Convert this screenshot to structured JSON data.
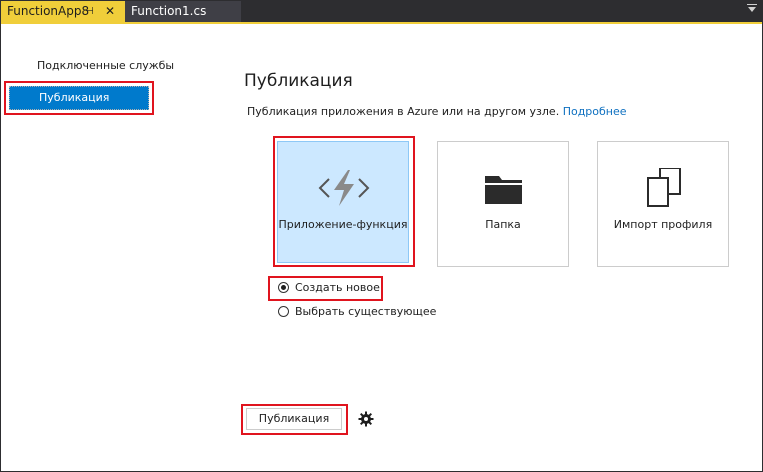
{
  "tabs": [
    {
      "label": "FunctionApp8",
      "active": true,
      "pin": "⊣",
      "close": "✕"
    },
    {
      "label": "Function1.cs",
      "active": false
    }
  ],
  "sidebar": {
    "items": [
      {
        "label": "Подключенные службы",
        "selected": false
      },
      {
        "label": "Публикация",
        "selected": true
      }
    ]
  },
  "main": {
    "title": "Публикация",
    "description": "Публикация приложения в Azure или на другом узле.",
    "learn_more": "Подробнее",
    "targets": [
      {
        "label": "Приложение-функция",
        "icon": "azure-function-icon",
        "selected": true
      },
      {
        "label": "Папка",
        "icon": "folder-icon",
        "selected": false
      },
      {
        "label": "Импорт профиля",
        "icon": "import-profile-icon",
        "selected": false
      }
    ],
    "options": [
      {
        "label": "Создать новое",
        "checked": true
      },
      {
        "label": "Выбрать существующее",
        "checked": false
      }
    ],
    "publish_button": "Публикация",
    "settings_icon": "gear-icon"
  },
  "colors": {
    "accent": "#007acc",
    "tab_active": "#f0ce3a",
    "highlight_box": "#e0141e",
    "selected_card": "#cce8ff",
    "link": "#0e70c0"
  }
}
